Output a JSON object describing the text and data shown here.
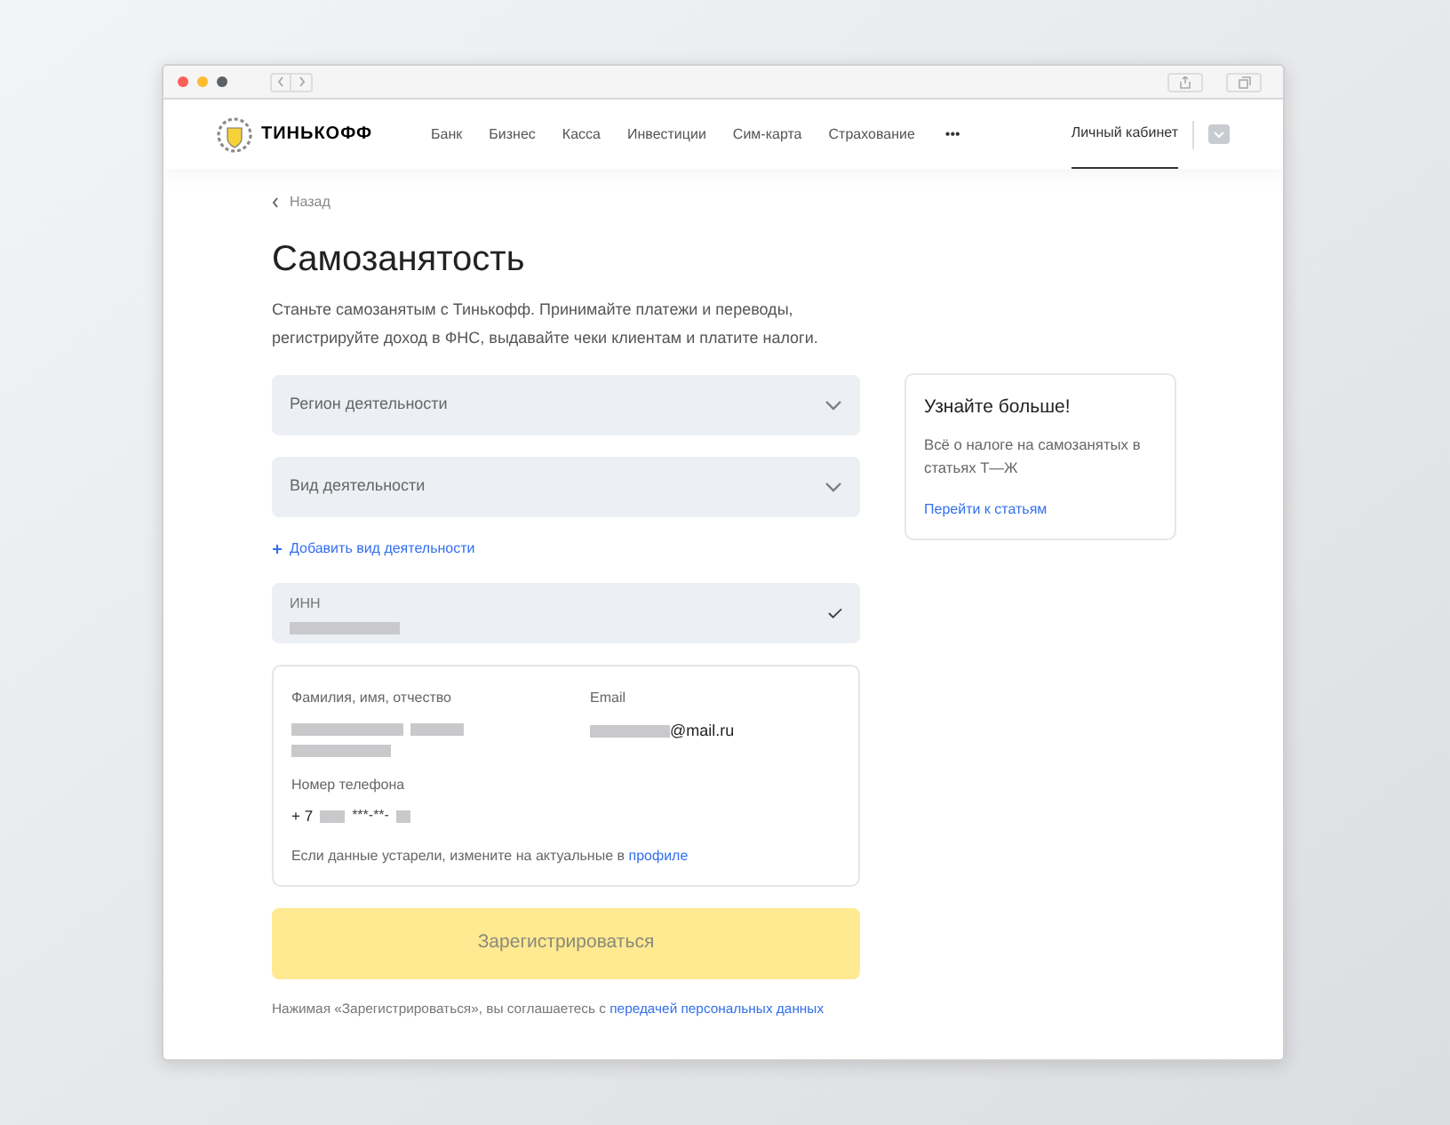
{
  "header": {
    "brand": "ТИНЬКОФФ",
    "links": [
      {
        "label": "Банк"
      },
      {
        "label": "Бизнес"
      },
      {
        "label": "Касса"
      },
      {
        "label": "Инвестиции"
      },
      {
        "label": "Сим-карта"
      },
      {
        "label": "Страхование"
      }
    ],
    "more": "•••",
    "account": {
      "label": "Личный кабинет",
      "selected": true
    }
  },
  "back": "Назад",
  "title": "Самозанятость",
  "intro": "Станьте самозанятым с Тинькофф. Принимайте платежи и переводы, регистрируйте доход в ФНС, выдавайте чеки клиентам и платите налоги.",
  "selects": [
    {
      "placeholder": "Регион деятельности"
    },
    {
      "placeholder": "Вид деятельности"
    }
  ],
  "add_activity": "Добавить вид деятельности",
  "inn": {
    "label": "ИНН",
    "verified": true
  },
  "profile": {
    "name_label": "Фамилия, имя, отчество",
    "email_label": "Email",
    "email_suffix": "@mail.ru",
    "phone_label": "Номер телефона",
    "phone_prefix": "+ 7",
    "phone_masked": "***-**-",
    "note": "Если данные устарели, измените на актуальные в",
    "note_link": "профиле"
  },
  "submit": {
    "label": "Зарегистрироваться",
    "disabled": true
  },
  "consent": "Нажимая «Зарегистрироваться», вы соглашаетесь с",
  "consent_link": "передачей персональных данных",
  "aside": {
    "title": "Узнайте больше!",
    "text": "Всё о налоге на самозанятых в статьях Т—Ж",
    "link": "Перейти к статьям"
  }
}
